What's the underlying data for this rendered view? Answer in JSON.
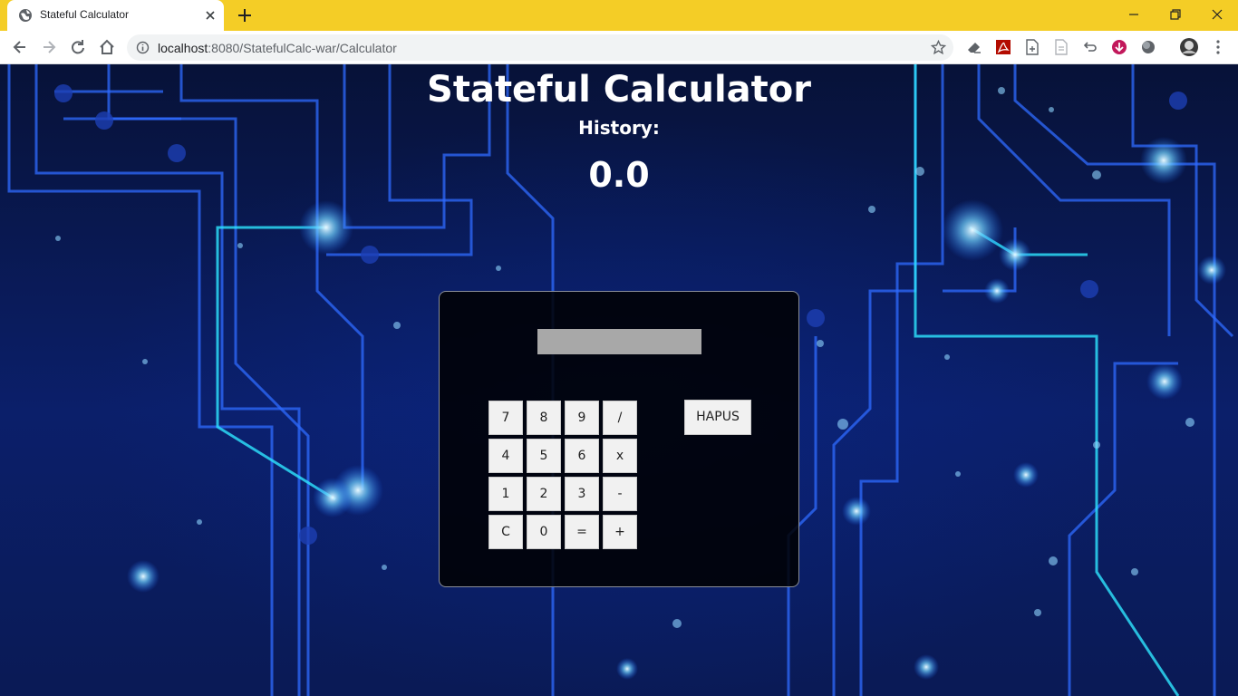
{
  "browser": {
    "tab_title": "Stateful Calculator",
    "url_host": "localhost",
    "url_rest": ":8080/StatefulCalc-war/Calculator",
    "titlebar_color": "#f4cd26"
  },
  "page": {
    "title": "Stateful Calculator",
    "history_label": "History:",
    "result": "0.0"
  },
  "calculator": {
    "input_value": "",
    "keys": {
      "k7": "7",
      "k8": "8",
      "k9": "9",
      "div": "/",
      "k4": "4",
      "k5": "5",
      "k6": "6",
      "mul": "x",
      "k1": "1",
      "k2": "2",
      "k3": "3",
      "sub": "-",
      "clear": "C",
      "k0": "0",
      "eq": "=",
      "add": "+"
    },
    "delete_label": "HAPUS"
  }
}
